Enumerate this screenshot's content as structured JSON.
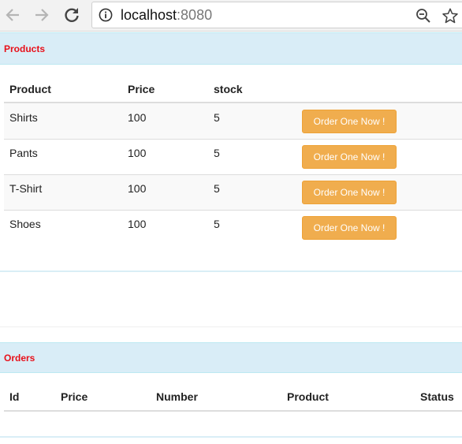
{
  "browser": {
    "url_host": "localhost",
    "url_port": ":8080",
    "icons": [
      "back-icon",
      "forward-icon",
      "reload-icon",
      "info-icon",
      "zoom-icon",
      "star-icon"
    ]
  },
  "products": {
    "title": "Products",
    "headers": {
      "product": "Product",
      "price": "Price",
      "stock": "stock"
    },
    "rows": [
      {
        "product": "Shirts",
        "price": "100",
        "stock": "5",
        "button": "Order One Now !"
      },
      {
        "product": "Pants",
        "price": "100",
        "stock": "5",
        "button": "Order One Now !"
      },
      {
        "product": "T-Shirt",
        "price": "100",
        "stock": "5",
        "button": "Order One Now !"
      },
      {
        "product": "Shoes",
        "price": "100",
        "stock": "5",
        "button": "Order One Now !"
      }
    ]
  },
  "orders": {
    "title": "Orders",
    "headers": {
      "id": "Id",
      "price": "Price",
      "number": "Number",
      "product": "Product",
      "status": "Status"
    }
  },
  "colors": {
    "panel_heading_bg": "#d9edf7",
    "panel_title": "#e8101a",
    "order_button": "#f0ad4e"
  }
}
